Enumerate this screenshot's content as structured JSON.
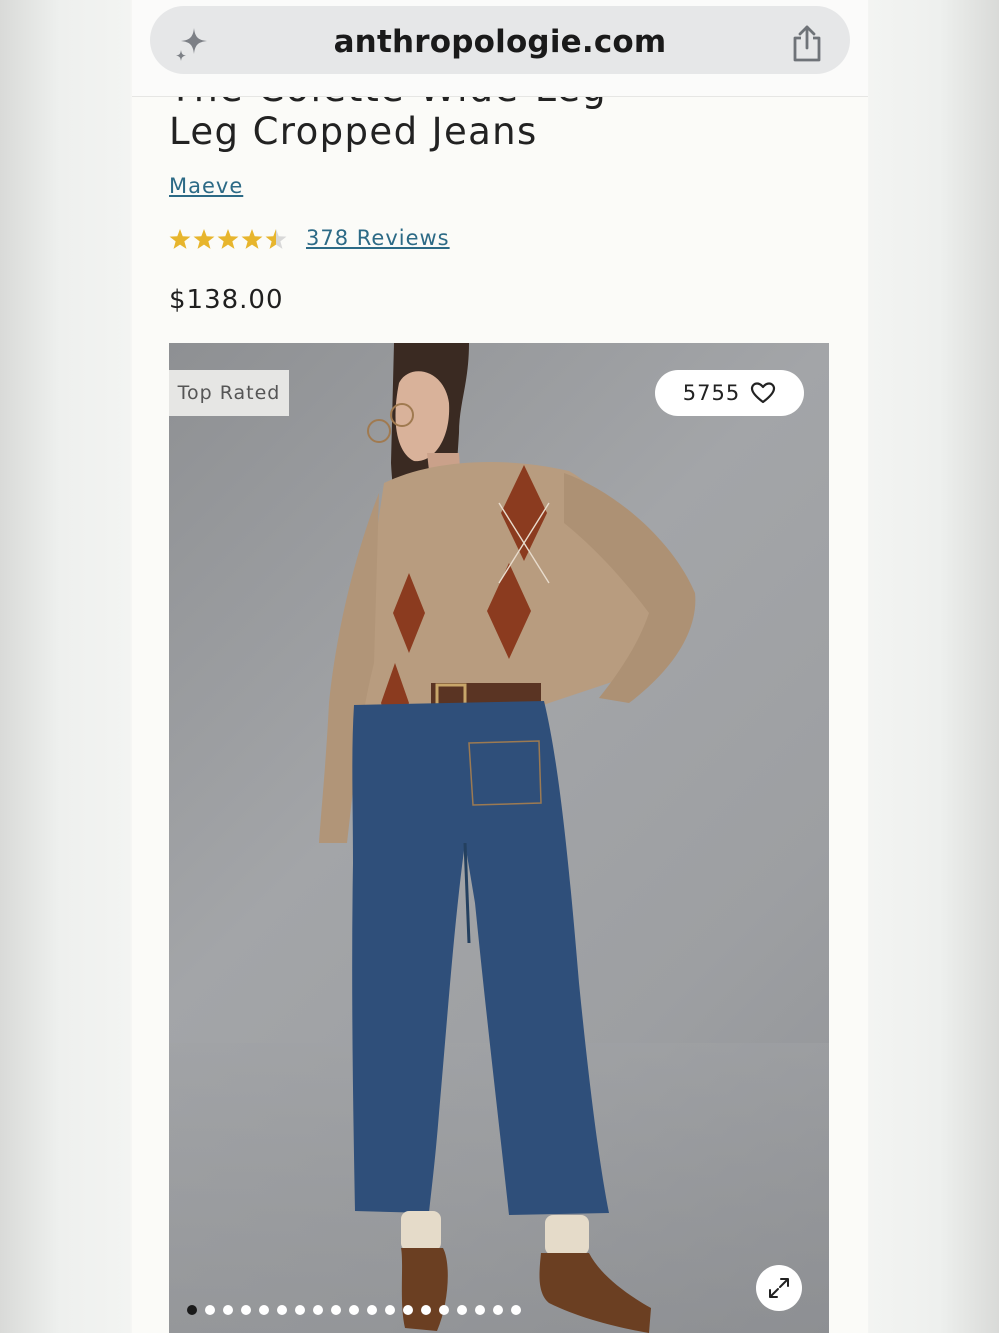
{
  "browser": {
    "url": "anthropologie.com",
    "icons": {
      "left": "sparkle-icon",
      "right": "share-icon"
    }
  },
  "product": {
    "title_clipped": "The Colette Wide-Leg",
    "title": "Leg Cropped Jeans",
    "brand": "Maeve",
    "rating": 4.5,
    "rating_max": 5,
    "reviews_label": "378 Reviews",
    "price": "$138.00"
  },
  "gallery": {
    "badge": "Top Rated",
    "favorites_count": "5755",
    "favorite_icon": "heart-icon",
    "expand_icon": "expand-icon",
    "image_count": 19,
    "active_index": 0
  },
  "colors": {
    "link": "#2c6a86",
    "star": "#e7b52d",
    "star_empty": "#d8d8d8"
  }
}
